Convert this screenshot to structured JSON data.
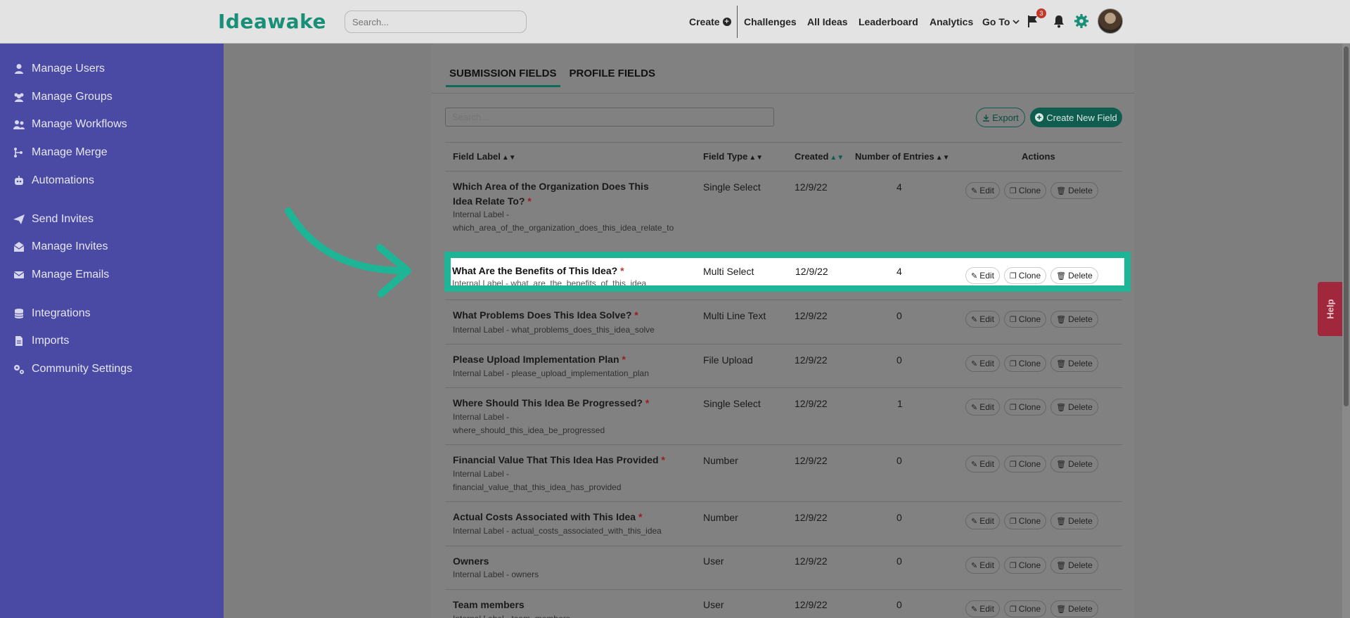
{
  "header": {
    "logo": "Ideawake",
    "search_placeholder": "Search...",
    "nav": {
      "create": "Create",
      "challenges": "Challenges",
      "all_ideas": "All Ideas",
      "leaderboard": "Leaderboard",
      "analytics": "Analytics",
      "go_to": "Go To"
    },
    "notification_count": "3",
    "accent_color": "#1a8f78"
  },
  "sidebar": {
    "bg_color": "#4a4aa5",
    "items": [
      {
        "label": "Manage Users",
        "icon": "user-icon"
      },
      {
        "label": "Manage Groups",
        "icon": "users-icon"
      },
      {
        "label": "Manage Workflows",
        "icon": "workflow-icon"
      },
      {
        "label": "Manage Merge",
        "icon": "merge-icon"
      },
      {
        "label": "Automations",
        "icon": "robot-icon"
      },
      {
        "label": "Send Invites",
        "icon": "paper-plane-icon"
      },
      {
        "label": "Manage Invites",
        "icon": "invites-icon"
      },
      {
        "label": "Manage Emails",
        "icon": "envelope-icon"
      },
      {
        "label": "Integrations",
        "icon": "database-icon"
      },
      {
        "label": "Imports",
        "icon": "file-icon"
      },
      {
        "label": "Community Settings",
        "icon": "gears-icon"
      }
    ]
  },
  "tabs": {
    "submission": "SUBMISSION FIELDS",
    "profile": "PROFILE FIELDS"
  },
  "toolbar": {
    "search_placeholder": "Search...",
    "export": "Export",
    "create_new": "Create New Field"
  },
  "table": {
    "headers": {
      "field_label": "Field Label",
      "field_type": "Field Type",
      "created": "Created",
      "entries": "Number of Entries",
      "actions": "Actions"
    },
    "action_labels": {
      "edit": "Edit",
      "clone": "Clone",
      "delete": "Delete"
    },
    "rows": [
      {
        "title": "Which Area of the Organization Does This Idea Relate To?",
        "required": "*",
        "internal": "Internal Label - which_area_of_the_organization_does_this_idea_relate_to",
        "type": "Single Select",
        "created": "12/9/22",
        "entries": "4"
      },
      {
        "title": "What Are the Benefits of This Idea?",
        "required": "*",
        "internal": "Internal Label - what_are_the_benefits_of_this_idea",
        "type": "Multi Select",
        "created": "12/9/22",
        "entries": "4"
      },
      {
        "title": "What Problems Does This Idea Solve?",
        "required": "*",
        "internal": "Internal Label - what_problems_does_this_idea_solve",
        "type": "Multi Line Text",
        "created": "12/9/22",
        "entries": "0"
      },
      {
        "title": "Please Upload Implementation Plan",
        "required": "*",
        "internal": "Internal Label - please_upload_implementation_plan",
        "type": "File Upload",
        "created": "12/9/22",
        "entries": "0"
      },
      {
        "title": "Where Should This Idea Be Progressed?",
        "required": "*",
        "internal": "Internal Label - where_should_this_idea_be_progressed",
        "type": "Single Select",
        "created": "12/9/22",
        "entries": "1"
      },
      {
        "title": "Financial Value That This Idea Has Provided",
        "required": "*",
        "internal": "Internal Label - financial_value_that_this_idea_has_provided",
        "type": "Number",
        "created": "12/9/22",
        "entries": "0"
      },
      {
        "title": "Actual Costs Associated with This Idea",
        "required": "*",
        "internal": "Internal Label - actual_costs_associated_with_this_idea",
        "type": "Number",
        "created": "12/9/22",
        "entries": "0"
      },
      {
        "title": "Owners",
        "required": "",
        "internal": "Internal Label - owners",
        "type": "User",
        "created": "12/9/22",
        "entries": "0"
      },
      {
        "title": "Team members",
        "required": "",
        "internal": "Internal Label - team_members",
        "type": "User",
        "created": "12/9/22",
        "entries": "0"
      }
    ]
  },
  "highlight_color": "#1db595",
  "help": {
    "label": "Help"
  }
}
